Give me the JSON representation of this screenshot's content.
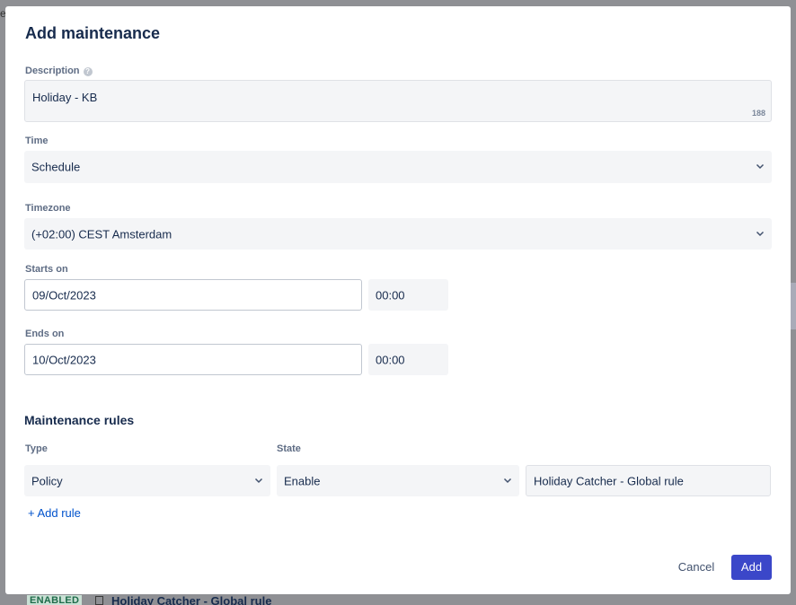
{
  "background": {
    "left_fragment": "e",
    "row_badge": "ENABLED",
    "row_text": "Holiday Catcher - Global rule"
  },
  "modal": {
    "title": "Add maintenance",
    "description": {
      "label": "Description",
      "help_icon": "question-circle-icon",
      "value": "Holiday - KB",
      "counter": "188"
    },
    "time": {
      "label": "Time",
      "value": "Schedule"
    },
    "timezone": {
      "label": "Timezone",
      "value": "(+02:00) CEST Amsterdam"
    },
    "starts_on": {
      "label": "Starts on",
      "date": "09/Oct/2023",
      "time": "00:00"
    },
    "ends_on": {
      "label": "Ends on",
      "date": "10/Oct/2023",
      "time": "00:00"
    },
    "rules": {
      "title": "Maintenance rules",
      "type_label": "Type",
      "state_label": "State",
      "type_value": "Policy",
      "state_value": "Enable",
      "target_value": "Holiday Catcher - Global rule",
      "add_rule_label": "+ Add rule"
    },
    "footer": {
      "cancel_label": "Cancel",
      "add_label": "Add"
    }
  },
  "colors": {
    "primary_button": "#3b47c9",
    "link": "#0052cc",
    "field_bg": "#f4f5f7"
  }
}
